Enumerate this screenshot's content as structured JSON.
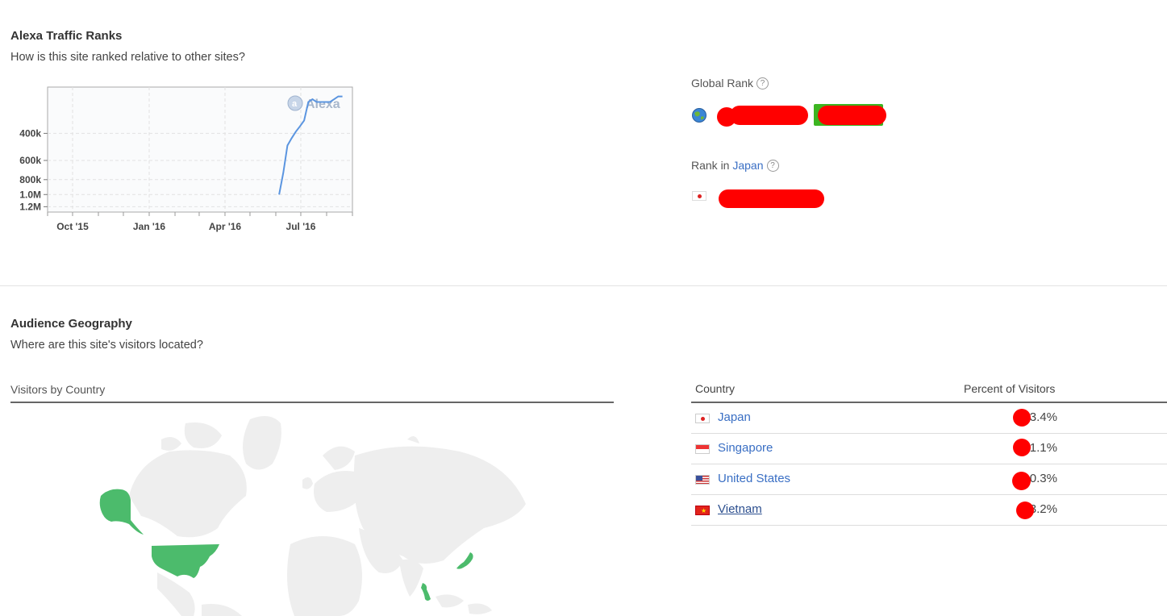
{
  "traffic": {
    "title": "Alexa Traffic Ranks",
    "subtitle": "How is this site ranked relative to other sites?",
    "global_rank_label": "Global Rank",
    "rank_in_label": "Rank in",
    "rank_country": "Japan",
    "help_glyph": "?"
  },
  "chart_data": {
    "type": "line",
    "watermark": "Alexa",
    "x_ticks": [
      "Oct '15",
      "Jan '16",
      "Apr '16",
      "Jul '16"
    ],
    "y_ticks": [
      "400k",
      "600k",
      "800k",
      "1.0M",
      "1.2M"
    ],
    "y_scale": "log-inverted",
    "x": [
      "2016-06-05",
      "2016-06-10",
      "2016-06-15",
      "2016-06-20",
      "2016-06-25",
      "2016-06-30",
      "2016-07-05",
      "2016-07-10",
      "2016-07-15",
      "2016-07-20",
      "2016-07-25",
      "2016-07-30",
      "2016-08-05",
      "2016-08-10",
      "2016-08-15",
      "2016-08-20"
    ],
    "y": [
      1000000,
      720000,
      480000,
      430000,
      390000,
      360000,
      330000,
      250000,
      240000,
      250000,
      250000,
      250000,
      250000,
      240000,
      230000,
      230000
    ],
    "grid": true
  },
  "geo": {
    "title": "Audience Geography",
    "subtitle": "Where are this site's visitors located?",
    "map_label": "Visitors by Country",
    "col_country": "Country",
    "col_percent": "Percent of Visitors",
    "rows": [
      {
        "country": "Japan",
        "pct": "3.4%"
      },
      {
        "country": "Singapore",
        "pct": "1.1%"
      },
      {
        "country": "United States",
        "pct": "0.3%"
      },
      {
        "country": "Vietnam",
        "pct": "3.2%"
      }
    ]
  },
  "colors": {
    "accent_link": "#3a6fc4",
    "map_highlight": "#4cbb6c",
    "map_land": "#eeeeee",
    "chart_line": "#5b95e0",
    "redaction": "#ff0000",
    "green_badge": "#3cb521"
  },
  "icons": {
    "globe": "globe-icon",
    "japan_flag": "japan-flag-icon"
  }
}
